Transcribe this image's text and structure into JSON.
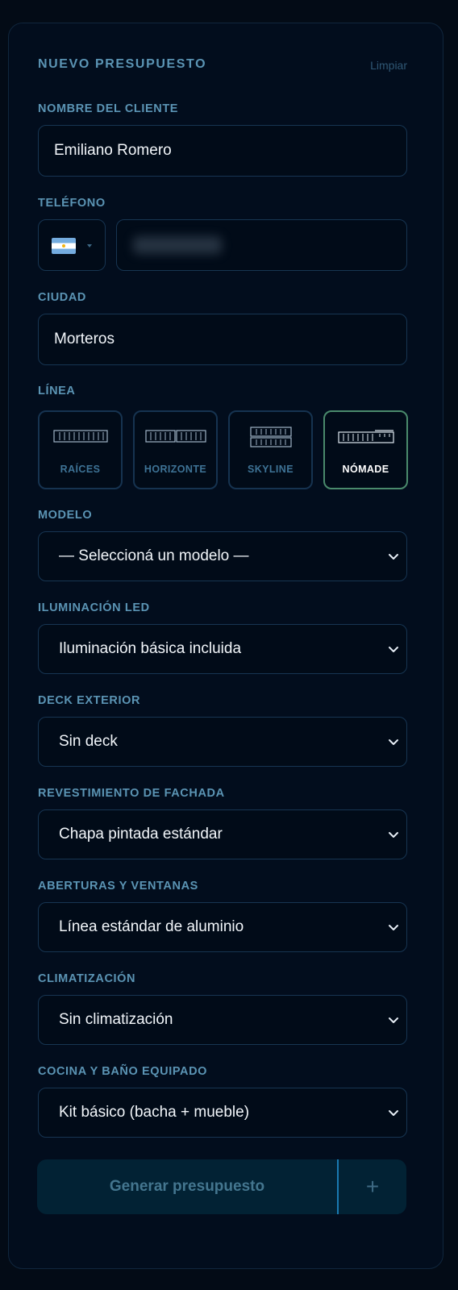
{
  "header": {
    "title": "NUEVO PRESUPUESTO",
    "clear_label": "Limpiar"
  },
  "client": {
    "label": "NOMBRE DEL CLIENTE",
    "value": "Emiliano Romero"
  },
  "phone": {
    "label": "TELÉFONO",
    "country_flag": "argentina-flag-icon"
  },
  "city": {
    "label": "CIUDAD",
    "value": "Morteros"
  },
  "line": {
    "label": "LÍNEA",
    "options": [
      {
        "name": "RAÍCES",
        "active": false
      },
      {
        "name": "HORIZONTE",
        "active": false
      },
      {
        "name": "SKYLINE",
        "active": false
      },
      {
        "name": "NÓMADE",
        "active": true
      }
    ]
  },
  "selects": [
    {
      "label": "MODELO",
      "value": "— Seleccioná un modelo —"
    },
    {
      "label": "ILUMINACIÓN LED",
      "value": "Iluminación básica incluida"
    },
    {
      "label": "DECK EXTERIOR",
      "value": "Sin deck"
    },
    {
      "label": "REVESTIMIENTO DE FACHADA",
      "value": "Chapa pintada estándar"
    },
    {
      "label": "ABERTURAS Y VENTANAS",
      "value": "Línea estándar de aluminio"
    },
    {
      "label": "CLIMATIZACIÓN",
      "value": "Sin climatización"
    },
    {
      "label": "COCINA Y BAÑO EQUIPADO",
      "value": "Kit básico (bacha + mueble)"
    }
  ],
  "actions": {
    "generate_label": "Generar presupuesto",
    "add_label": "+"
  },
  "colors": {
    "accent": "#5b94b4",
    "active_border": "#4a8a6c",
    "divider": "#1a7ab2"
  }
}
